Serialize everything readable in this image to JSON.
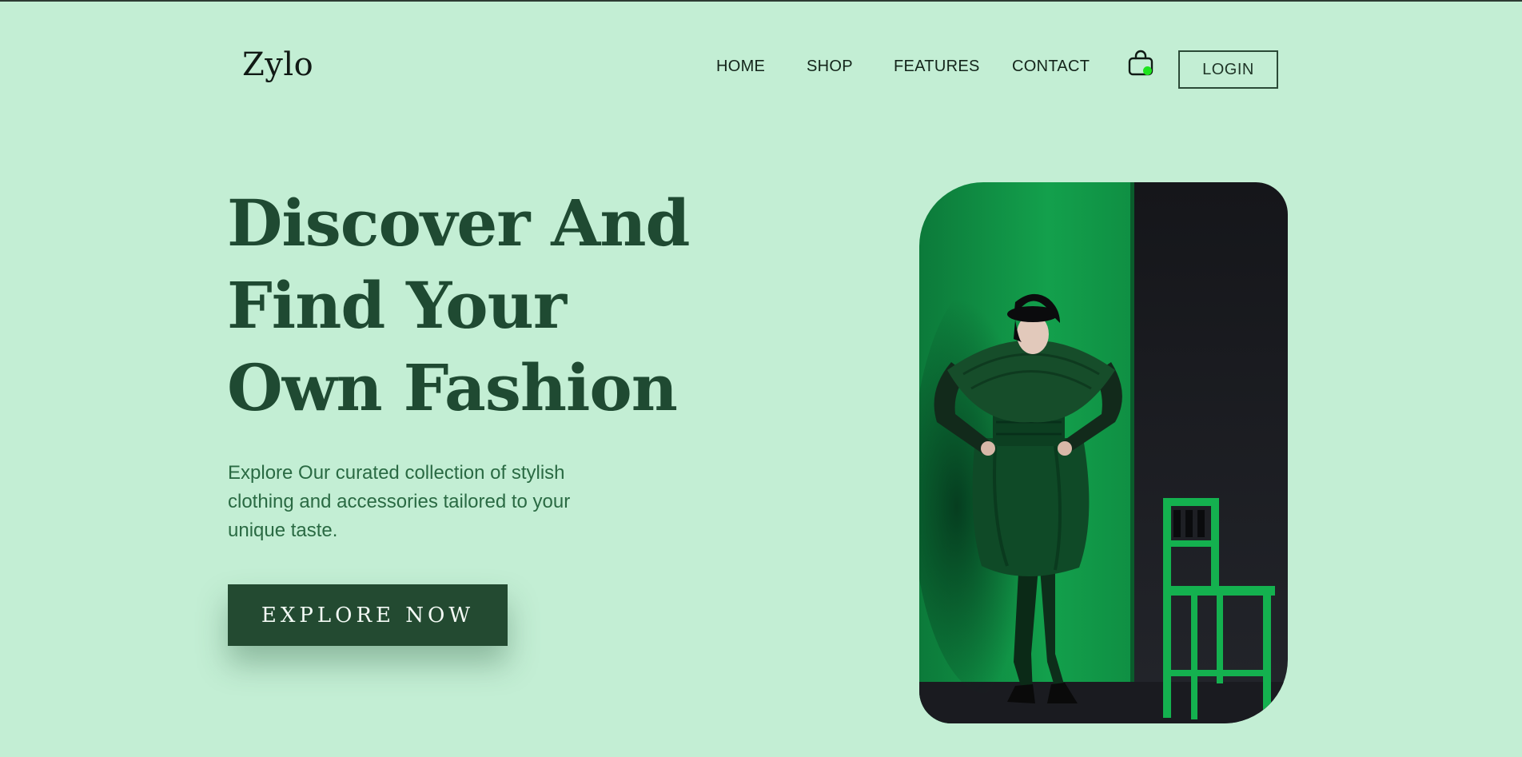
{
  "brand": {
    "name": "Zylo"
  },
  "nav": {
    "items": [
      {
        "label": "HOME"
      },
      {
        "label": "SHOP"
      },
      {
        "label": "FEATURES"
      },
      {
        "label": "CONTACT"
      }
    ],
    "cart_icon": "shopping-bag-icon",
    "cart_has_items": true,
    "login_label": "LOGIN"
  },
  "hero": {
    "title_lines": [
      "Discover And",
      "Find Your",
      "Own Fashion"
    ],
    "subtitle_lines": [
      "Explore Our curated collection of stylish",
      "clothing and accessories tailored to your",
      "unique taste."
    ],
    "cta_label": "EXPLORE NOW",
    "image_subject": "model-in-green-dress-with-green-chair"
  },
  "colors": {
    "background": "#c3eed4",
    "heading": "#1f4a32",
    "subtitle": "#2a6a43",
    "cta_bg": "#234a31",
    "cart_badge": "#1ee41e"
  }
}
